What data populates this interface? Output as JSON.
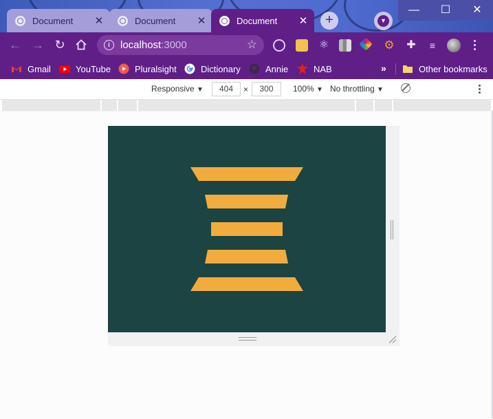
{
  "browser": {
    "tabs": [
      {
        "label": "Document",
        "close": "✕",
        "active": false
      },
      {
        "label": "Document",
        "close": "✕",
        "active": false
      },
      {
        "label": "Document",
        "close": "✕",
        "active": true
      }
    ],
    "new_tab_symbol": "+",
    "window_controls": {
      "minimize": "—",
      "maximize": "☐",
      "close": "✕"
    },
    "url": {
      "host": "localhost",
      "port": ":3000"
    },
    "extensions": [
      "target-icon",
      "notes-icon",
      "react-devtools-icon",
      "chart-extension-icon",
      "color-picker-icon",
      "gear-extension-icon",
      "puzzle-extensions-icon",
      "playlist-icon",
      "profile-avatar-icon"
    ]
  },
  "bookmarks": {
    "items": [
      {
        "label": "Gmail",
        "icon": "gmail-icon"
      },
      {
        "label": "YouTube",
        "icon": "youtube-icon"
      },
      {
        "label": "Pluralsight",
        "icon": "pluralsight-icon"
      },
      {
        "label": "Dictionary",
        "icon": "google-icon"
      },
      {
        "label": "Annie",
        "icon": "github-icon"
      },
      {
        "label": "NAB",
        "icon": "nab-icon"
      }
    ],
    "more": "»",
    "other": "Other bookmarks"
  },
  "devtools": {
    "device": "Responsive",
    "width": "404",
    "times": "×",
    "height": "300",
    "zoom": "100%",
    "throttling": "No throttling",
    "caret": "▼"
  },
  "page": {
    "background": "#1b4442",
    "stripe_color": "#f2ab3d",
    "stripes": 5
  }
}
